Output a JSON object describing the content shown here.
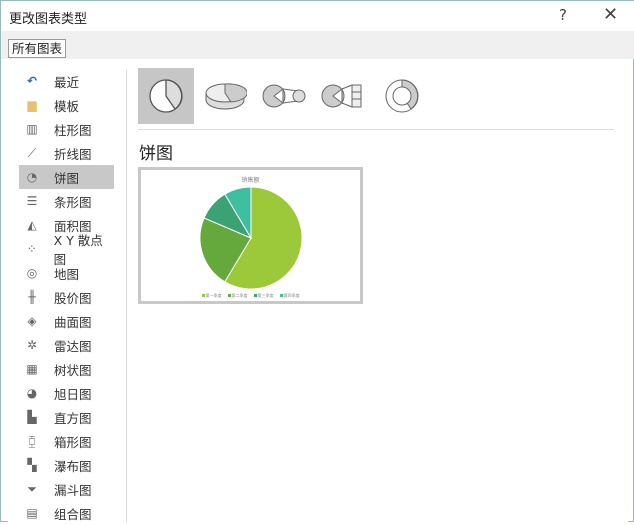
{
  "window": {
    "title": "更改图表类型",
    "help": "?",
    "close": "✕"
  },
  "tab": "所有图表",
  "sidebar": {
    "items": [
      {
        "label": "最近",
        "icon": "recent-icon",
        "g": "↶"
      },
      {
        "label": "模板",
        "icon": "folder-icon",
        "g": "▆"
      },
      {
        "label": "柱形图",
        "icon": "column-chart-icon",
        "g": "▥"
      },
      {
        "label": "折线图",
        "icon": "line-chart-icon",
        "g": "⟋"
      },
      {
        "label": "饼图",
        "icon": "pie-chart-icon",
        "g": "◔"
      },
      {
        "label": "条形图",
        "icon": "bar-chart-icon",
        "g": "☰"
      },
      {
        "label": "面积图",
        "icon": "area-chart-icon",
        "g": "◭"
      },
      {
        "label": "X Y 散点图",
        "icon": "scatter-chart-icon",
        "g": "⁘"
      },
      {
        "label": "地图",
        "icon": "map-icon",
        "g": "◎"
      },
      {
        "label": "股价图",
        "icon": "stock-chart-icon",
        "g": "╫"
      },
      {
        "label": "曲面图",
        "icon": "surface-chart-icon",
        "g": "◈"
      },
      {
        "label": "雷达图",
        "icon": "radar-chart-icon",
        "g": "✲"
      },
      {
        "label": "树状图",
        "icon": "treemap-icon",
        "g": "▦"
      },
      {
        "label": "旭日图",
        "icon": "sunburst-icon",
        "g": "◕"
      },
      {
        "label": "直方图",
        "icon": "histogram-icon",
        "g": "▙"
      },
      {
        "label": "箱形图",
        "icon": "box-whisker-icon",
        "g": "⧮"
      },
      {
        "label": "瀑布图",
        "icon": "waterfall-icon",
        "g": "▚"
      },
      {
        "label": "漏斗图",
        "icon": "funnel-icon",
        "g": "⏷"
      },
      {
        "label": "组合图",
        "icon": "combo-chart-icon",
        "g": "▤"
      }
    ],
    "selected": 4
  },
  "section_title": "饼图",
  "chart_data": {
    "type": "pie",
    "title": "销售额",
    "categories": [
      "第一季度",
      "第二季度",
      "第三季度",
      "第四季度"
    ],
    "values": [
      8.2,
      3.2,
      1.4,
      1.2
    ],
    "colors": [
      "#9bc93a",
      "#65a83b",
      "#3aa273",
      "#3fbfa0"
    ]
  }
}
